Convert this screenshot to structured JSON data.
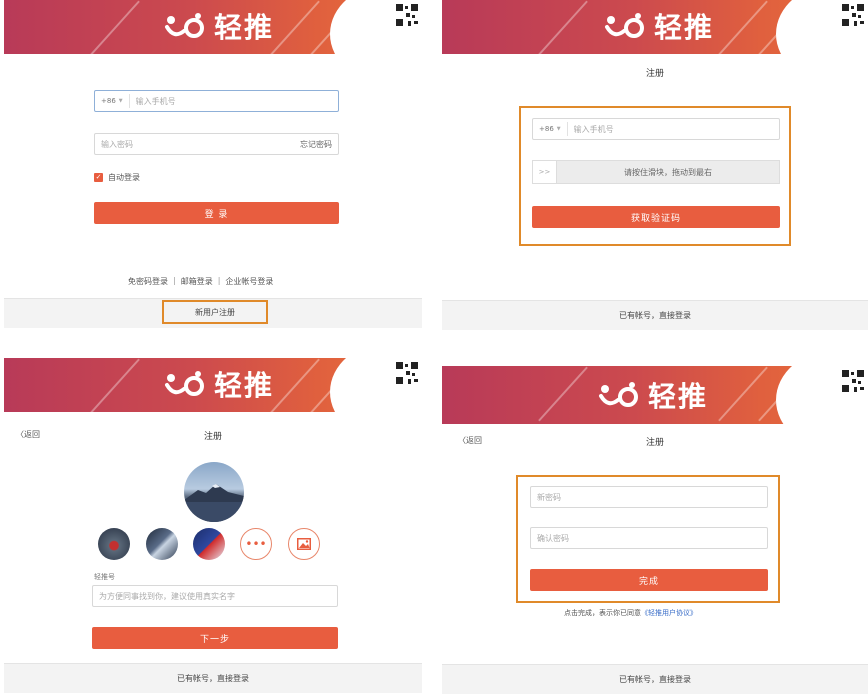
{
  "brand": {
    "logo_text": "轻推"
  },
  "panel_login": {
    "country_code": "+86",
    "phone_placeholder": "输入手机号",
    "password_placeholder": "输入密码",
    "forgot_password": "忘记密码",
    "remember_label": "自动登录",
    "login_button": "登 录",
    "alt_login": [
      "免密码登录",
      "邮箱登录",
      "企业帐号登录"
    ],
    "register_link": "新用户注册"
  },
  "panel_register_phone": {
    "title": "注册",
    "country_code": "+86",
    "phone_placeholder": "输入手机号",
    "slider_handle": ">>",
    "slider_text": "请按住滑块，拖动到最右",
    "get_code_button": "获取验证码",
    "footer": "已有帐号，直接登录"
  },
  "panel_register_profile": {
    "back": "〈返回",
    "title": "注册",
    "name_label": "轻推号",
    "name_placeholder": "为方便同事找到你，建议使用真实名字",
    "more_icon": "•••",
    "next_button": "下一步",
    "footer": "已有帐号，直接登录"
  },
  "panel_register_password": {
    "back": "〈返回",
    "title": "注册",
    "new_password_placeholder": "新密码",
    "confirm_password_placeholder": "确认密码",
    "done_button": "完成",
    "agree_text": "点击完成，表示你已同意",
    "agree_link": "《轻推用户协议》",
    "footer": "已有帐号，直接登录"
  },
  "colors": {
    "accent": "#e85d3f",
    "highlight": "#e08a2a",
    "banner_start": "#b83a58",
    "banner_end": "#e8703a"
  }
}
